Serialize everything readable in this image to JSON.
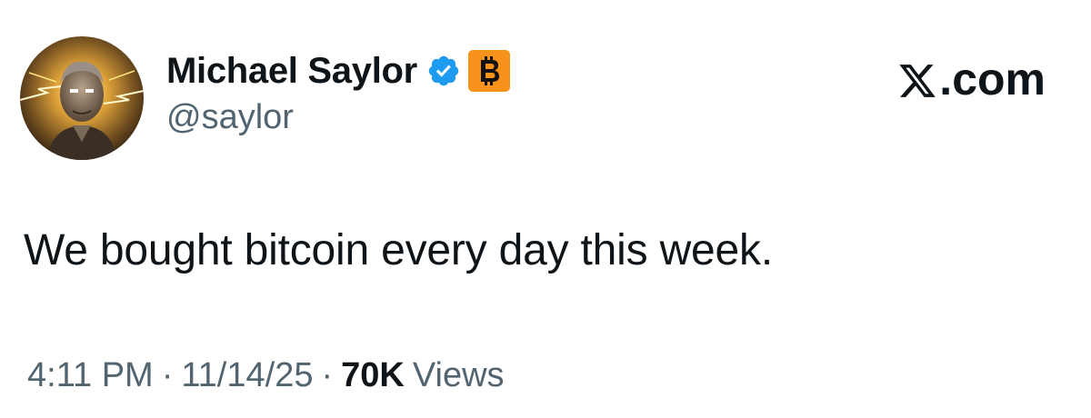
{
  "author": {
    "display_name": "Michael Saylor",
    "handle": "@saylor",
    "verified": true,
    "badge_icon": "bitcoin-icon",
    "avatar_icon": "profile-photo"
  },
  "site": {
    "label": ".com",
    "logo_icon": "x-logo-icon"
  },
  "tweet": {
    "text": "We bought bitcoin every day this week.",
    "time": "4:11 PM",
    "separator": "·",
    "date": "11/14/25",
    "views_count": "70K",
    "views_label": "Views"
  },
  "colors": {
    "text_primary": "#0f1419",
    "text_secondary": "#536471",
    "verified_blue": "#1d9bf0",
    "bitcoin_orange": "#f7931a"
  }
}
